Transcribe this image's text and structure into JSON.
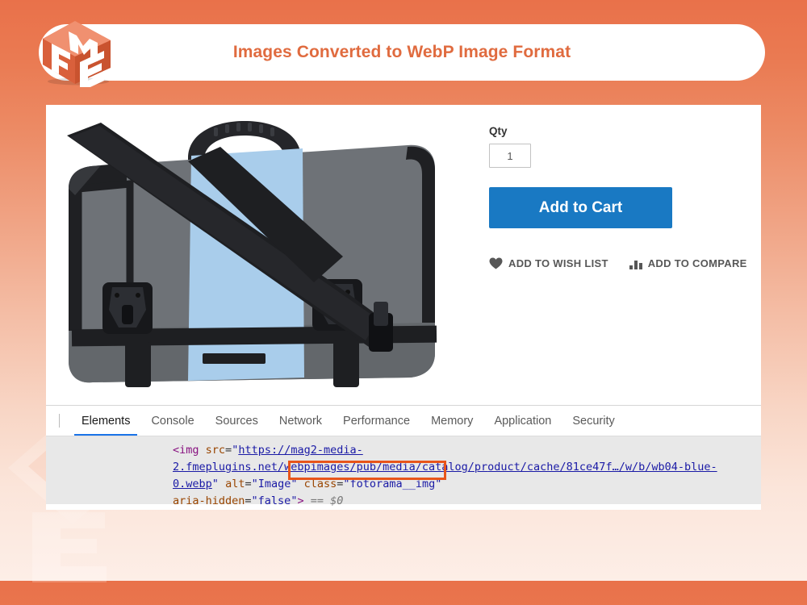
{
  "page": {
    "background_top_color": "#e9714a",
    "background_bottom_color": "#fdeee7",
    "watermark_icon": "fme-cube-logo-watermark"
  },
  "header": {
    "title": "Images Converted to WebP Image Format",
    "title_color": "#e06b3f",
    "logo_icon": "fme-cube-logo",
    "logo_letters": {
      "f": "F",
      "m": "M",
      "e": "E"
    }
  },
  "product": {
    "image_icon": "messenger-bag-product-photo",
    "image_alt": "Image",
    "qty": {
      "label": "Qty",
      "value": "1",
      "placeholder": "1"
    },
    "add_to_cart_label": "Add to Cart",
    "add_to_cart_color": "#1979c3",
    "wish_list": {
      "label": "Add to Wish List",
      "icon": "heart-icon"
    },
    "compare": {
      "label": "Add to Compare",
      "icon": "bar-chart-icon"
    }
  },
  "devtools": {
    "tabs": [
      {
        "label": "Elements",
        "active": true
      },
      {
        "label": "Console",
        "active": false
      },
      {
        "label": "Sources",
        "active": false
      },
      {
        "label": "Network",
        "active": false
      },
      {
        "label": "Performance",
        "active": false
      },
      {
        "label": "Memory",
        "active": false
      },
      {
        "label": "Application",
        "active": false
      },
      {
        "label": "Security",
        "active": false
      }
    ],
    "active_tab_underline_color": "#1a73e8",
    "code": {
      "tag_open": "<img",
      "attr_src": "src",
      "eq": "=",
      "quote": "\"",
      "url_part1": "https://mag2-media-2.fmeplugins.net/webpimages/pub/media/catalog/pr",
      "url_part2": "oduct/cache/81ce47f…/",
      "url_highlighted": "w/b/wb04-blue-0.webp",
      "attr_alt": "alt",
      "val_alt": "\"Image\"",
      "attr_class": "class",
      "val_class": "\"fotorama__img\"",
      "attr_aria": "aria-hidden",
      "val_aria": "\"false\"",
      "tag_close": ">",
      "selected_ref": "== $0",
      "highlight_color": "#e8551a"
    }
  }
}
